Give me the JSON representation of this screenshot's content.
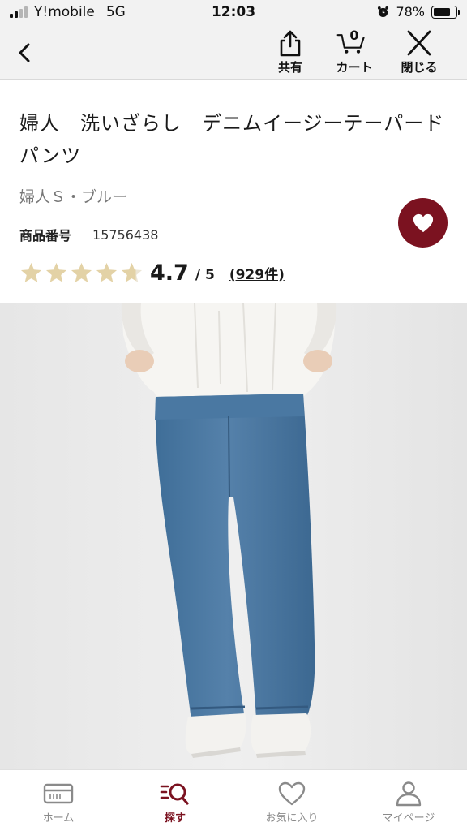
{
  "status_bar": {
    "carrier": "Y!mobile",
    "network": "5G",
    "time": "12:03",
    "battery_percent": "78%",
    "battery_level": 0.78
  },
  "header": {
    "share_label": "共有",
    "cart_label": "カート",
    "cart_count": "0",
    "close_label": "閉じる"
  },
  "product": {
    "title": "婦人　洗いざらし　デニムイージーテーパードパンツ",
    "variant": "婦人Ｓ・ブルー",
    "code_label": "商品番号",
    "code_value": "15756438",
    "rating_value": "4.7",
    "rating_max": "/ 5",
    "rating_stars": 4.7,
    "review_count": "(929件)"
  },
  "tabs": [
    {
      "label": "ホーム",
      "icon": "home-card-icon",
      "active": false
    },
    {
      "label": "探す",
      "icon": "search-list-icon",
      "active": true
    },
    {
      "label": "お気に入り",
      "icon": "heart-outline-icon",
      "active": false
    },
    {
      "label": "マイページ",
      "icon": "person-icon",
      "active": false
    }
  ],
  "colors": {
    "accent": "#7b1220",
    "star": "#e3d2a6",
    "header_bg": "#f2f2f2"
  }
}
